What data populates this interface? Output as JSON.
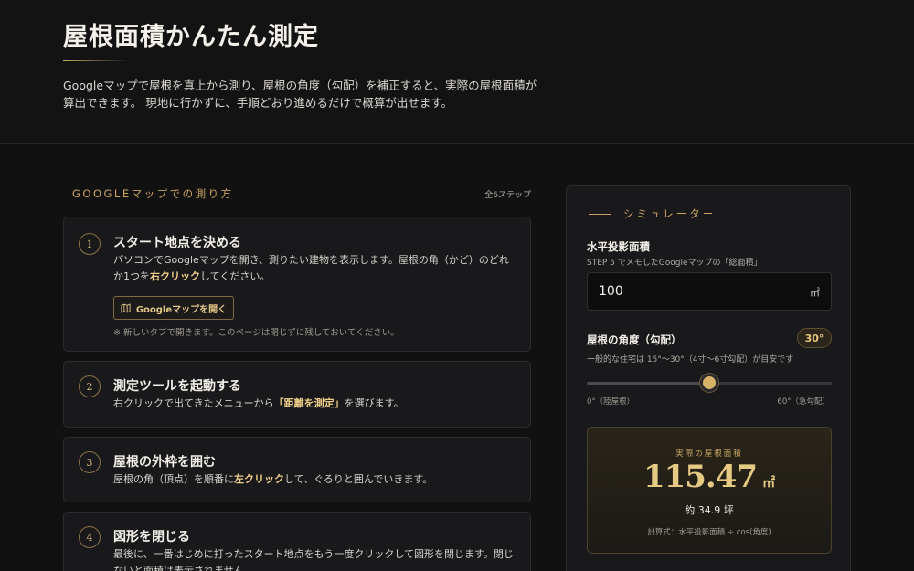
{
  "header": {
    "title": "屋根面積かんたん測定",
    "intro": "Googleマップで屋根を真上から測り、屋根の角度（勾配）を補正すると、実際の屋根面積が算出できます。 現地に行かずに、手順どおり進めるだけで概算が出せます。"
  },
  "guide": {
    "heading": "GOOGLEマップでの測り方",
    "step_count": "全6ステップ",
    "steps": [
      {
        "num": "1",
        "title": "スタート地点を決める",
        "body_before": "パソコンでGoogleマップを開き、測りたい建物を表示します。屋根の角（かど）のどれか1つを",
        "body_highlight": "右クリック",
        "body_after": "してください。",
        "button_label": "Googleマップを開く",
        "note": "※ 新しいタブで開きます。このページは閉じずに残しておいてください。"
      },
      {
        "num": "2",
        "title": "測定ツールを起動する",
        "body_before": "右クリックで出てきたメニューから",
        "body_highlight": "「距離を測定」",
        "body_after": "を選びます。"
      },
      {
        "num": "3",
        "title": "屋根の外枠を囲む",
        "body_before": "屋根の角（頂点）を順番に",
        "body_highlight": "左クリック",
        "body_after": "して、ぐるりと囲んでいきます。"
      },
      {
        "num": "4",
        "title": "図形を閉じる",
        "body_before": "最後に、一番はじめに打ったスタート地点をもう一度クリックして図形を閉じます。閉じないと面積は表示されません。",
        "body_highlight": "",
        "body_after": ""
      }
    ]
  },
  "simulator": {
    "heading": "シミュレーター",
    "area_label": "水平投影面積",
    "area_hint": "STEP 5 でメモしたGoogleマップの「総面積」",
    "area_value": "100",
    "area_unit": "㎡",
    "angle_label": "屋根の角度（勾配）",
    "angle_badge": "30°",
    "angle_hint": "一般的な住宅は 15°〜30°（4寸〜6寸勾配）が目安です",
    "angle_value": 30,
    "angle_max": 60,
    "slider_min_label": "0°（陸屋根）",
    "slider_max_label": "60°（急勾配）",
    "result_label": "実際の屋根面積",
    "result_value": "115.47",
    "result_unit": "㎡",
    "result_tsubo": "約 34.9 坪",
    "result_formula": "計算式：水平投影面積 ÷ cos(角度)"
  },
  "colors": {
    "accent_gold": "#c9a561",
    "background": "#111112",
    "card": "#19191b"
  },
  "icons": {
    "map_button_icon": "map-icon"
  }
}
